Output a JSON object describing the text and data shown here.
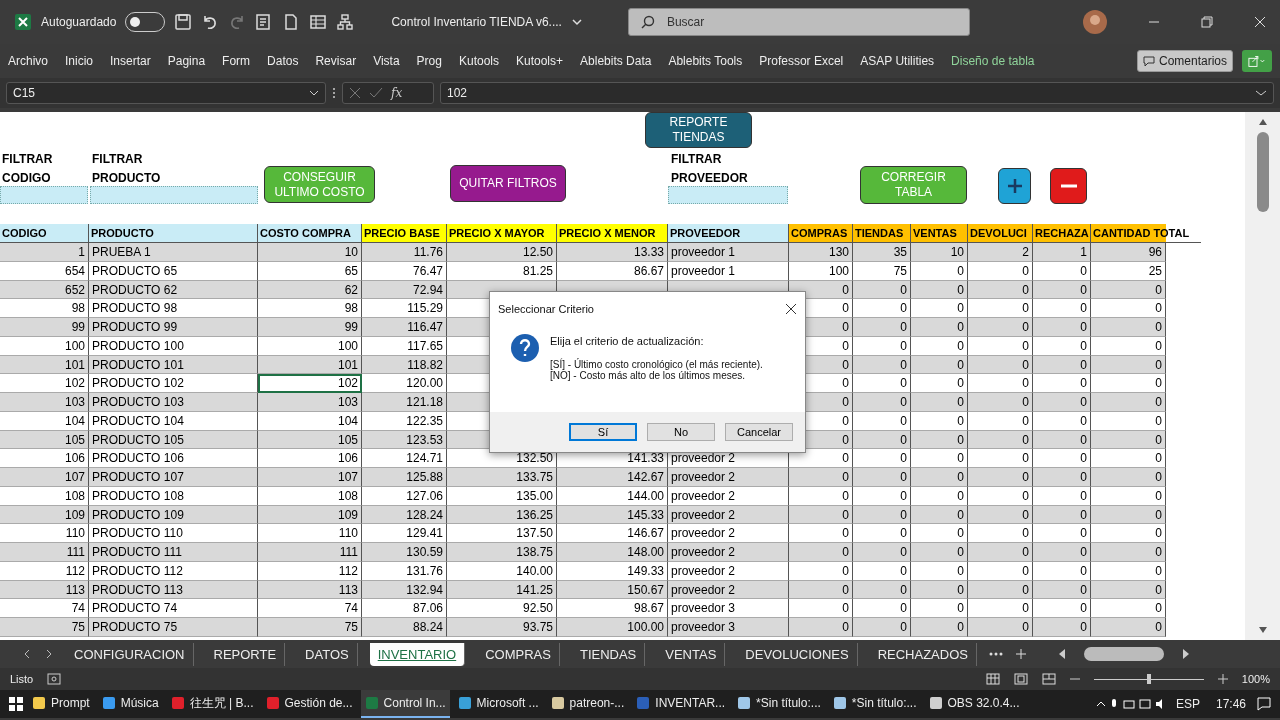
{
  "title_bar": {
    "autosave_label": "Autoguardado",
    "autosave_on": false,
    "document_title": "Control Inventario TIENDA v6....",
    "search": {
      "placeholder": "Buscar"
    }
  },
  "menu": [
    {
      "label": "Archivo",
      "kind": "tab"
    },
    {
      "label": "Inicio",
      "kind": "tab"
    },
    {
      "label": "Insertar",
      "kind": "tab"
    },
    {
      "label": "Pagina",
      "kind": "tab"
    },
    {
      "label": "Form",
      "kind": "tab"
    },
    {
      "label": "Datos",
      "kind": "tab"
    },
    {
      "label": "Revisar",
      "kind": "tab"
    },
    {
      "label": "Vista",
      "kind": "tab"
    },
    {
      "label": "Prog",
      "kind": "tab"
    },
    {
      "label": "Kutools",
      "kind": "tab"
    },
    {
      "label": "Kutools+",
      "kind": "tab"
    },
    {
      "label": "Ablebits Data",
      "kind": "tab"
    },
    {
      "label": "Ablebits Tools",
      "kind": "tab"
    },
    {
      "label": "Professor Excel",
      "kind": "tab"
    },
    {
      "label": "ASAP Utilities",
      "kind": "tab"
    },
    {
      "label": "Diseño de tabla",
      "kind": "contextual"
    }
  ],
  "comments_button": "Comentarios",
  "formula_bar": {
    "name_box": "C15",
    "function_label": "fx",
    "value": "102"
  },
  "filters": [
    {
      "lines": [
        "FILTRAR",
        "CODIGO"
      ]
    },
    {
      "lines": [
        "FILTRAR",
        "PRODUCTO"
      ]
    },
    {
      "lines": [
        "FILTRAR",
        "PROVEEDOR"
      ]
    }
  ],
  "shape_buttons": [
    {
      "kind": "text",
      "lines": [
        "REPORTE",
        "TIENDAS"
      ],
      "color": "#1d6077"
    },
    {
      "kind": "text",
      "lines": [
        "CONSEGUIR",
        "ULTIMO COSTO"
      ],
      "color": "#56b83a"
    },
    {
      "kind": "text",
      "lines": [
        "QUITAR FILTROS"
      ],
      "color": "#961a8e"
    },
    {
      "kind": "text",
      "lines": [
        "CORREGIR",
        "TABLA"
      ],
      "color": "#56b83a"
    },
    {
      "kind": "plus",
      "color": "#1fa3d6"
    },
    {
      "kind": "minus",
      "color": "#e01b1b"
    }
  ],
  "columns": [
    {
      "label": "CODIGO",
      "color": "#c9ecf6"
    },
    {
      "label": "PRODUCTO",
      "color": "#c9ecf6"
    },
    {
      "label": "COSTO COMPRA",
      "color": "#c9ecf6"
    },
    {
      "label": "PRECIO BASE",
      "color": "#ffff00"
    },
    {
      "label": "PRECIO X MAYOR",
      "color": "#ffff00"
    },
    {
      "label": "PRECIO X MENOR",
      "color": "#ffff00"
    },
    {
      "label": "PROVEEDOR",
      "color": "#c9ecf6"
    },
    {
      "label": "COMPRAS",
      "color": "#ffc000"
    },
    {
      "label": "TIENDAS",
      "color": "#ffc000"
    },
    {
      "label": "VENTAS",
      "color": "#ffc000"
    },
    {
      "label": "DEVOLUCI",
      "color": "#ffc000"
    },
    {
      "label": "RECHAZA",
      "color": "#ffc000"
    },
    {
      "label": "CANTIDAD TOTAL",
      "color": "#ffc000"
    }
  ],
  "rows": [
    {
      "selected": false,
      "cells": [
        "1",
        "PRUEBA 1",
        "10",
        "11.76",
        "12.50",
        "13.33",
        "proveedor 1",
        "130",
        "35",
        "10",
        "2",
        "1",
        "96"
      ]
    },
    {
      "selected": false,
      "cells": [
        "654",
        "PRODUCTO 65",
        "65",
        "76.47",
        "81.25",
        "86.67",
        "proveedor 1",
        "100",
        "75",
        "0",
        "0",
        "0",
        "25"
      ]
    },
    {
      "selected": false,
      "cells": [
        "652",
        "PRODUCTO 62",
        "62",
        "72.94",
        null,
        null,
        null,
        "0",
        "0",
        "0",
        "0",
        "0",
        "0"
      ]
    },
    {
      "selected": false,
      "cells": [
        "98",
        "PRODUCTO 98",
        "98",
        "115.29",
        null,
        null,
        null,
        "0",
        "0",
        "0",
        "0",
        "0",
        "0"
      ]
    },
    {
      "selected": false,
      "cells": [
        "99",
        "PRODUCTO 99",
        "99",
        "116.47",
        null,
        null,
        null,
        "0",
        "0",
        "0",
        "0",
        "0",
        "0"
      ]
    },
    {
      "selected": false,
      "cells": [
        "100",
        "PRODUCTO 100",
        "100",
        "117.65",
        null,
        null,
        null,
        "0",
        "0",
        "0",
        "0",
        "0",
        "0"
      ]
    },
    {
      "selected": false,
      "cells": [
        "101",
        "PRODUCTO 101",
        "101",
        "118.82",
        null,
        null,
        null,
        "0",
        "0",
        "0",
        "0",
        "0",
        "0"
      ]
    },
    {
      "selected": true,
      "cells": [
        "102",
        "PRODUCTO 102",
        "102",
        "120.00",
        null,
        null,
        null,
        "0",
        "0",
        "0",
        "0",
        "0",
        "0"
      ]
    },
    {
      "selected": false,
      "cells": [
        "103",
        "PRODUCTO 103",
        "103",
        "121.18",
        null,
        null,
        null,
        "0",
        "0",
        "0",
        "0",
        "0",
        "0"
      ]
    },
    {
      "selected": false,
      "cells": [
        "104",
        "PRODUCTO 104",
        "104",
        "122.35",
        null,
        null,
        null,
        "0",
        "0",
        "0",
        "0",
        "0",
        "0"
      ]
    },
    {
      "selected": false,
      "cells": [
        "105",
        "PRODUCTO 105",
        "105",
        "123.53",
        null,
        null,
        null,
        "0",
        "0",
        "0",
        "0",
        "0",
        "0"
      ]
    },
    {
      "selected": false,
      "cells": [
        "106",
        "PRODUCTO 106",
        "106",
        "124.71",
        "132.50",
        "141.33",
        "proveedor 2",
        "0",
        "0",
        "0",
        "0",
        "0",
        "0"
      ]
    },
    {
      "selected": false,
      "cells": [
        "107",
        "PRODUCTO 107",
        "107",
        "125.88",
        "133.75",
        "142.67",
        "proveedor 2",
        "0",
        "0",
        "0",
        "0",
        "0",
        "0"
      ]
    },
    {
      "selected": false,
      "cells": [
        "108",
        "PRODUCTO 108",
        "108",
        "127.06",
        "135.00",
        "144.00",
        "proveedor 2",
        "0",
        "0",
        "0",
        "0",
        "0",
        "0"
      ]
    },
    {
      "selected": false,
      "cells": [
        "109",
        "PRODUCTO 109",
        "109",
        "128.24",
        "136.25",
        "145.33",
        "proveedor 2",
        "0",
        "0",
        "0",
        "0",
        "0",
        "0"
      ]
    },
    {
      "selected": false,
      "cells": [
        "110",
        "PRODUCTO 110",
        "110",
        "129.41",
        "137.50",
        "146.67",
        "proveedor 2",
        "0",
        "0",
        "0",
        "0",
        "0",
        "0"
      ]
    },
    {
      "selected": false,
      "cells": [
        "111",
        "PRODUCTO 111",
        "111",
        "130.59",
        "138.75",
        "148.00",
        "proveedor 2",
        "0",
        "0",
        "0",
        "0",
        "0",
        "0"
      ]
    },
    {
      "selected": false,
      "cells": [
        "112",
        "PRODUCTO 112",
        "112",
        "131.76",
        "140.00",
        "149.33",
        "proveedor 2",
        "0",
        "0",
        "0",
        "0",
        "0",
        "0"
      ]
    },
    {
      "selected": false,
      "cells": [
        "113",
        "PRODUCTO 113",
        "113",
        "132.94",
        "141.25",
        "150.67",
        "proveedor 2",
        "0",
        "0",
        "0",
        "0",
        "0",
        "0"
      ]
    },
    {
      "selected": false,
      "cells": [
        "74",
        "PRODUCTO 74",
        "74",
        "87.06",
        "92.50",
        "98.67",
        "proveedor 3",
        "0",
        "0",
        "0",
        "0",
        "0",
        "0"
      ]
    },
    {
      "selected": false,
      "cells": [
        "75",
        "PRODUCTO 75",
        "75",
        "88.24",
        "93.75",
        "100.00",
        "proveedor 3",
        "0",
        "0",
        "0",
        "0",
        "0",
        "0"
      ]
    }
  ],
  "dialog": {
    "title": "Seleccionar Criterio",
    "message": "Elija el criterio de actualización:",
    "options": [
      "[SÍ] - Último costo cronológico (el más reciente).",
      "[NO] - Costo más alto de los últimos meses."
    ],
    "buttons": [
      {
        "label": "Sí",
        "selected": true
      },
      {
        "label": "No",
        "selected": false
      },
      {
        "label": "Cancelar",
        "selected": false
      }
    ]
  },
  "sheet_tabs": [
    {
      "label": "CONFIGURACION",
      "selected": false
    },
    {
      "label": "REPORTE",
      "selected": false
    },
    {
      "label": "DATOS",
      "selected": false
    },
    {
      "label": "INVENTARIO",
      "selected": true
    },
    {
      "label": "COMPRAS",
      "selected": false
    },
    {
      "label": "TIENDAS",
      "selected": false
    },
    {
      "label": "VENTAS",
      "selected": false
    },
    {
      "label": "DEVOLUCIONES",
      "selected": false
    },
    {
      "label": "RECHAZADOS",
      "selected": false
    }
  ],
  "status_bar": {
    "status": "Listo",
    "zoom_slider": {
      "level": 0.5
    },
    "zoom": "100%"
  },
  "taskbar": {
    "items": [
      {
        "label": "Prompt",
        "kind": "folder",
        "selected": false
      },
      {
        "label": "Música",
        "kind": "music",
        "selected": false
      },
      {
        "label": "往生咒 | B...",
        "kind": "opera",
        "selected": false
      },
      {
        "label": "Gestión de...",
        "kind": "opera",
        "selected": false
      },
      {
        "label": "Control In...",
        "kind": "excel",
        "selected": true
      },
      {
        "label": "Microsoft ...",
        "kind": "photos",
        "selected": false
      },
      {
        "label": "patreon-...",
        "kind": "app",
        "selected": false
      },
      {
        "label": "INVENTAR...",
        "kind": "word",
        "selected": false
      },
      {
        "label": "*Sin título:...",
        "kind": "notepad",
        "selected": false
      },
      {
        "label": "*Sin título:...",
        "kind": "notepad",
        "selected": false
      },
      {
        "label": "OBS 32.0.4...",
        "kind": "obs",
        "selected": false
      }
    ],
    "language": "ESP",
    "time": "17:46"
  }
}
